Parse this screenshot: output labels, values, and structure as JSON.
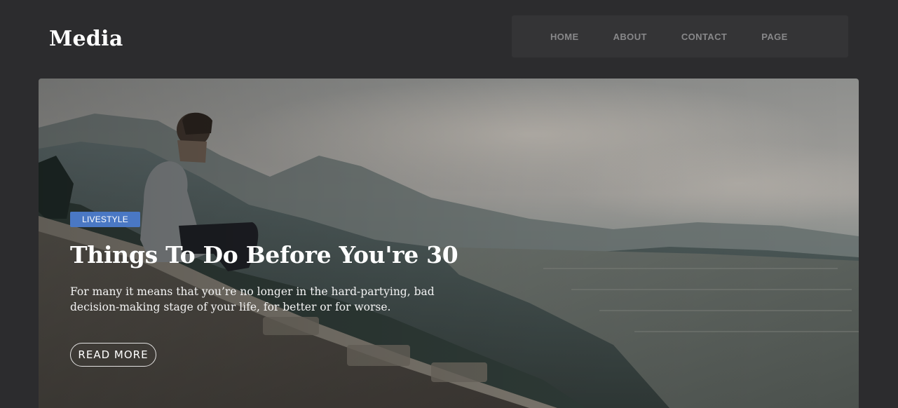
{
  "header": {
    "logo": "Media",
    "nav": [
      {
        "label": "HOME"
      },
      {
        "label": "ABOUT"
      },
      {
        "label": "CONTACT"
      },
      {
        "label": "PAGE"
      }
    ]
  },
  "hero": {
    "category": "LIVESTYLE",
    "title": "Things To Do Before You're 30",
    "excerpt": "For many it means that you’re no longer in the hard-partying, bad decision-making stage of your life, for better or for worse.",
    "button_label": "READ  MORE",
    "image": "man-sitting-on-stone-wall-overlooking-misty-valley-and-city"
  },
  "colors": {
    "page_background": "#2c2c2e",
    "nav_background": "#343436",
    "nav_text": "#88888a",
    "badge": "#4a78c4"
  }
}
